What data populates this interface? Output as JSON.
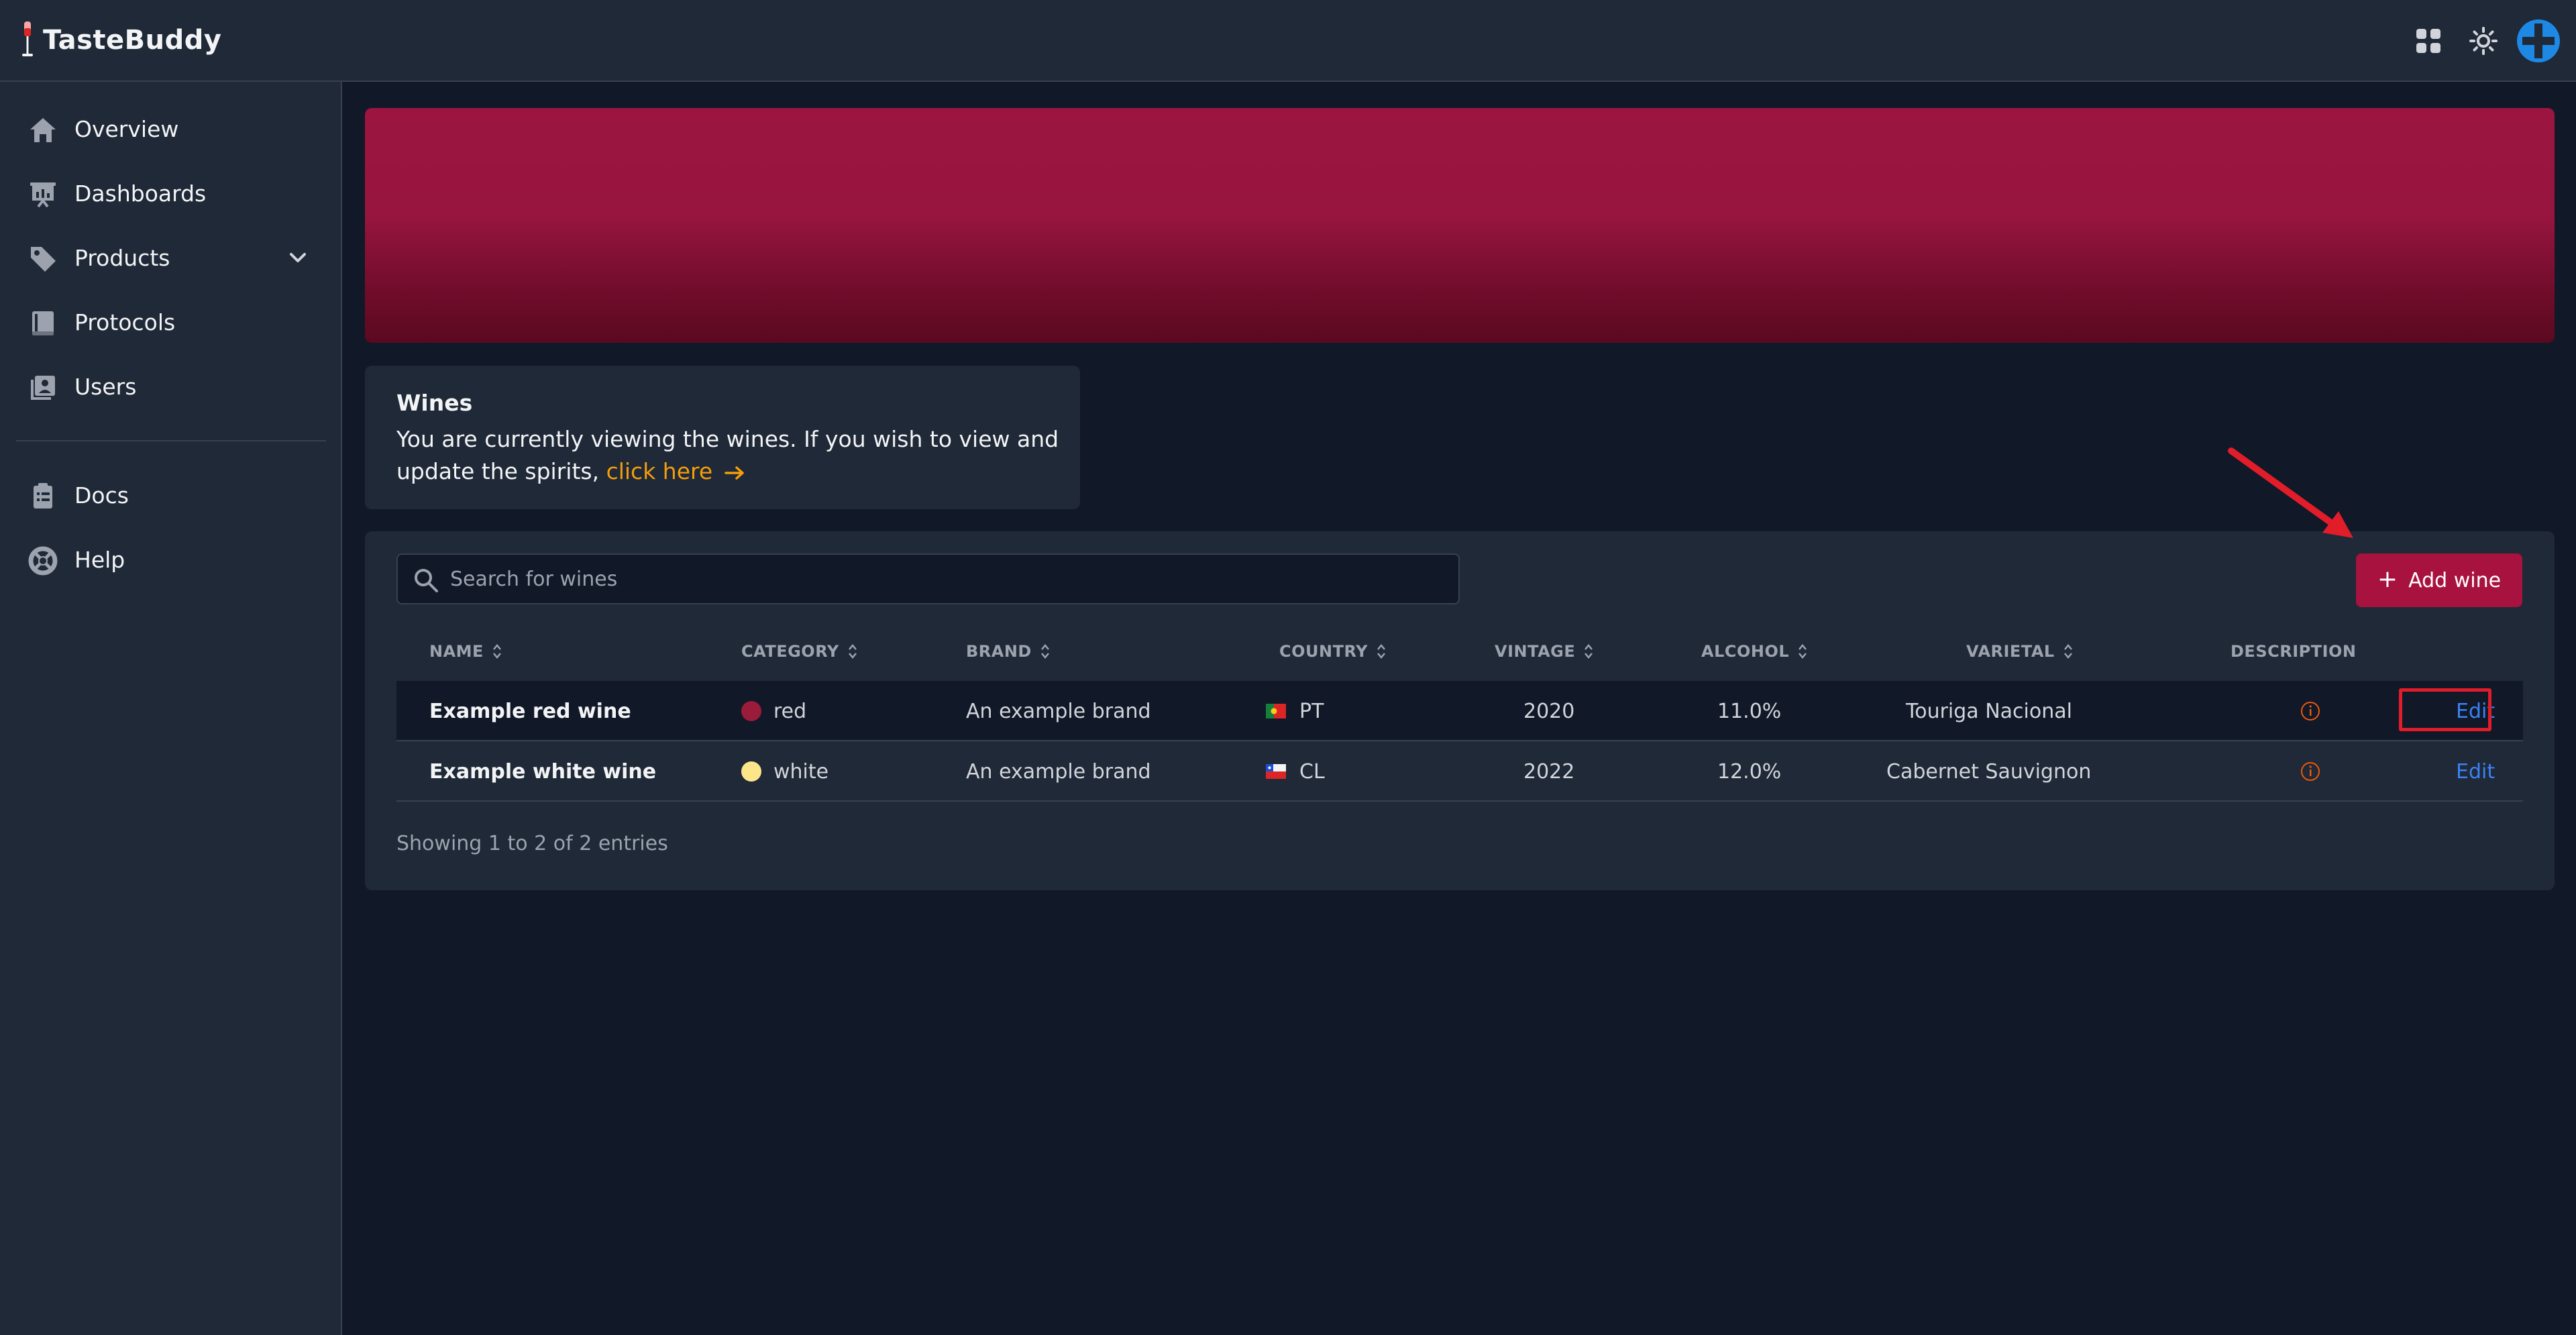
{
  "app": {
    "name": "TasteBuddy"
  },
  "sidebar": {
    "items": [
      {
        "label": "Overview",
        "icon": "home-icon"
      },
      {
        "label": "Dashboards",
        "icon": "presentation-chart-icon"
      },
      {
        "label": "Products",
        "icon": "tag-icon"
      },
      {
        "label": "Protocols",
        "icon": "book-icon"
      },
      {
        "label": "Users",
        "icon": "user-group-icon"
      },
      {
        "label": "Docs",
        "icon": "clipboard-icon"
      },
      {
        "label": "Help",
        "icon": "lifebuoy-icon"
      }
    ]
  },
  "info": {
    "title": "Wines",
    "text": "You are currently viewing the wines. If you wish to view and update the spirits,",
    "link": "click here"
  },
  "search": {
    "placeholder": "Search for wines"
  },
  "add_button": {
    "label": "Add wine"
  },
  "table": {
    "headers": [
      "NAME",
      "CATEGORY",
      "BRAND",
      "COUNTRY",
      "VINTAGE",
      "ALCOHOL",
      "VARIETAL",
      "DESCRIPTION"
    ],
    "rows": [
      {
        "name": "Example red wine",
        "category": "red",
        "category_color": "#9b1b3a",
        "brand": "An example brand",
        "country": "PT",
        "vintage": "2020",
        "alcohol": "11.0%",
        "varietal": "Touriga Nacional",
        "action": "Edit"
      },
      {
        "name": "Example white wine",
        "category": "white",
        "category_color": "#fde68a",
        "brand": "An example brand",
        "country": "CL",
        "vintage": "2022",
        "alcohol": "12.0%",
        "varietal": "Cabernet Sauvignon",
        "action": "Edit"
      }
    ],
    "footer": "Showing 1 to 2 of 2 entries"
  },
  "colors": {
    "accent": "#a8123f",
    "link": "#f59e0b",
    "edit": "#3b82f6",
    "annotation": "#e11d2a"
  }
}
